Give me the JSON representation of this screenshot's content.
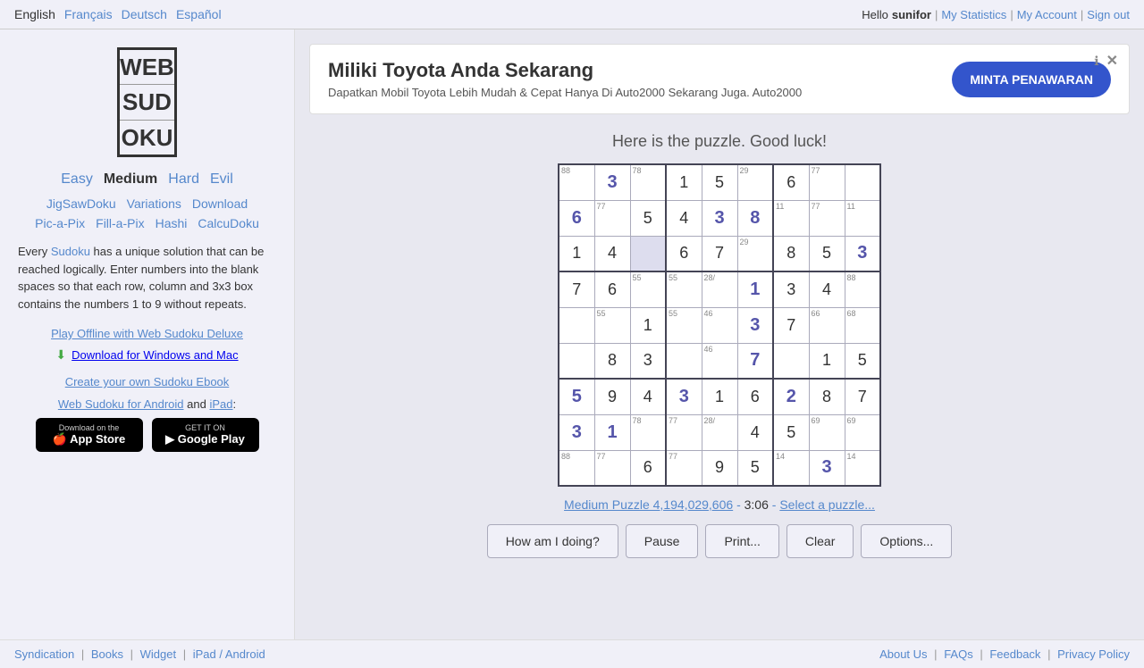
{
  "topnav": {
    "languages": [
      "English",
      "Français",
      "Deutsch",
      "Español"
    ],
    "hello_prefix": "Hello ",
    "username": "sunifor",
    "my_statistics": "My Statistics",
    "my_account": "My Account",
    "sign_out": "Sign out"
  },
  "logo": {
    "lines": [
      "WEB",
      "SUD",
      "OKU"
    ]
  },
  "difficulty": {
    "items": [
      "Easy",
      "Medium",
      "Hard",
      "Evil"
    ],
    "selected": "Medium"
  },
  "subnav1": [
    "JigSawDoku",
    "Variations",
    "Download"
  ],
  "subnav2": [
    "Pic-a-Pix",
    "Fill-a-Pix",
    "Hashi",
    "CalcuDoku"
  ],
  "description": "Every Sudoku has a unique solution that can be reached logically. Enter numbers into the blank spaces so that each row, column and 3x3 box contains the numbers 1 to 9 without repeats.",
  "promo": {
    "main_link": "Play Offline with Web Sudoku Deluxe",
    "sub_link": "Download for Windows and Mac",
    "ebook_link": "Create your own Sudoku Ebook",
    "mobile_text1": "Web Sudoku for Android",
    "mobile_and": "and",
    "mobile_text2": "iPad",
    "mobile_colon": ":"
  },
  "stores": {
    "apple_top": "Download on the",
    "apple_main": "App Store",
    "google_top": "GET IT ON",
    "google_main": "Google Play"
  },
  "ad": {
    "title": "Miliki Toyota Anda Sekarang",
    "body": "Dapatkan Mobil Toyota Lebih Mudah & Cepat Hanya Di Auto2000 Sekarang Juga.\nAuto2000",
    "cta": "MINTA PENAWARAN"
  },
  "puzzle": {
    "subtitle": "Here is the puzzle. Good luck!",
    "info_label": "Medium Puzzle 4,194,029,606",
    "time": "3:06",
    "select_link": "Select a puzzle...",
    "cells": [
      [
        {
          "v": "88",
          "t": "pencil"
        },
        {
          "v": "3",
          "t": "user"
        },
        {
          "v": "78",
          "t": "pencil"
        },
        {
          "v": "1",
          "t": "given"
        },
        {
          "v": "5",
          "t": "given"
        },
        {
          "v": "29",
          "t": "pencil"
        },
        {
          "v": "6",
          "t": "given"
        },
        {
          "v": "77",
          "t": "pencil"
        },
        {
          "v": "",
          "t": "empty"
        }
      ],
      [
        {
          "v": "6",
          "t": "user"
        },
        {
          "v": "77",
          "t": "pencil"
        },
        {
          "v": "5",
          "t": "given"
        },
        {
          "v": "4",
          "t": "given"
        },
        {
          "v": "3",
          "t": "user"
        },
        {
          "v": "8",
          "t": "user"
        },
        {
          "v": "11",
          "t": "pencil"
        },
        {
          "v": "77",
          "t": "pencil"
        },
        {
          "v": "11",
          "t": "pencil"
        }
      ],
      [
        {
          "v": "1",
          "t": "given"
        },
        {
          "v": "4",
          "t": "given"
        },
        {
          "v": "",
          "t": "input"
        },
        {
          "v": "6",
          "t": "given"
        },
        {
          "v": "7",
          "t": "given"
        },
        {
          "v": "29",
          "t": "pencil"
        },
        {
          "v": "8",
          "t": "given"
        },
        {
          "v": "5",
          "t": "given"
        },
        {
          "v": "3",
          "t": "user"
        }
      ],
      [
        {
          "v": "7",
          "t": "given"
        },
        {
          "v": "6",
          "t": "given"
        },
        {
          "v": "55",
          "t": "pencil"
        },
        {
          "v": "55",
          "t": "pencil"
        },
        {
          "v": "28/",
          "t": "pencil"
        },
        {
          "v": "1",
          "t": "user"
        },
        {
          "v": "3",
          "t": "given"
        },
        {
          "v": "4",
          "t": "given"
        },
        {
          "v": "88",
          "t": "pencil"
        }
      ],
      [
        {
          "v": "",
          "t": "empty"
        },
        {
          "v": "55",
          "t": "pencil"
        },
        {
          "v": "1",
          "t": "given"
        },
        {
          "v": "55",
          "t": "pencil"
        },
        {
          "v": "46",
          "t": "pencil"
        },
        {
          "v": "3",
          "t": "user"
        },
        {
          "v": "7",
          "t": "given"
        },
        {
          "v": "66",
          "t": "pencil"
        },
        {
          "v": "68",
          "t": "pencil"
        }
      ],
      [
        {
          "v": "",
          "t": "empty"
        },
        {
          "v": "8",
          "t": "given"
        },
        {
          "v": "3",
          "t": "given"
        },
        {
          "v": "",
          "t": "empty"
        },
        {
          "v": "46",
          "t": "pencil"
        },
        {
          "v": "7",
          "t": "user"
        },
        {
          "v": "",
          "t": "empty"
        },
        {
          "v": "1",
          "t": "given"
        },
        {
          "v": "5",
          "t": "given"
        }
      ],
      [
        {
          "v": "5",
          "t": "user"
        },
        {
          "v": "9",
          "t": "given"
        },
        {
          "v": "4",
          "t": "given"
        },
        {
          "v": "3",
          "t": "user"
        },
        {
          "v": "1",
          "t": "given"
        },
        {
          "v": "6",
          "t": "given"
        },
        {
          "v": "2",
          "t": "user"
        },
        {
          "v": "8",
          "t": "given"
        },
        {
          "v": "7",
          "t": "given"
        }
      ],
      [
        {
          "v": "3",
          "t": "user"
        },
        {
          "v": "1",
          "t": "user"
        },
        {
          "v": "78",
          "t": "pencil"
        },
        {
          "v": "77",
          "t": "pencil"
        },
        {
          "v": "28/",
          "t": "pencil"
        },
        {
          "v": "4",
          "t": "given"
        },
        {
          "v": "5",
          "t": "given"
        },
        {
          "v": "69",
          "t": "pencil"
        },
        {
          "v": "69",
          "t": "pencil"
        }
      ],
      [
        {
          "v": "88",
          "t": "pencil"
        },
        {
          "v": "77",
          "t": "pencil"
        },
        {
          "v": "6",
          "t": "given"
        },
        {
          "v": "77",
          "t": "pencil"
        },
        {
          "v": "9",
          "t": "given"
        },
        {
          "v": "5",
          "t": "given"
        },
        {
          "v": "14",
          "t": "pencil"
        },
        {
          "v": "3",
          "t": "user"
        },
        {
          "v": "14",
          "t": "pencil"
        }
      ]
    ]
  },
  "buttons": {
    "how": "How am I doing?",
    "pause": "Pause",
    "print": "Print...",
    "clear": "Clear",
    "options": "Options..."
  },
  "footer": {
    "items1": [
      "Syndication",
      "Books",
      "Widget",
      "iPad / Android"
    ],
    "items2": [
      "About Us",
      "FAQs",
      "Feedback",
      "Privacy Policy"
    ]
  }
}
